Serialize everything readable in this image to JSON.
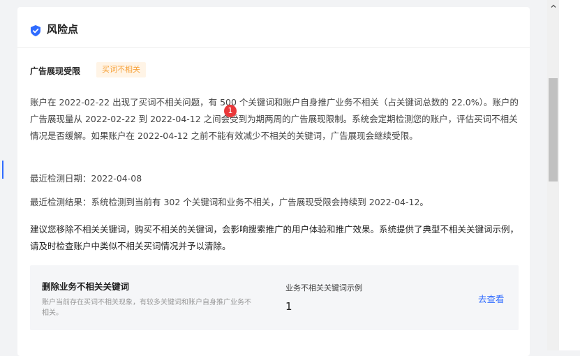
{
  "card": {
    "title": "风险点",
    "icon": "shield-check-icon",
    "accent_color": "#2f6bff"
  },
  "issue": {
    "title": "广告展现受限",
    "tag": "买词不相关",
    "tag_color": "#f7a23a"
  },
  "body": {
    "paragraph1": "账户在 2022-02-22 出现了买词不相关问题，有 500 个关键词和账户自身推广业务不相关（占关键词总数的 22.0%）。账户的广告展现量从 2022-02-22 到 2022-04-12 之间会受到为期两周的广告展现限制。系统会定期检测您的账户，评估买词不相关情况是否缓解。如果账户在 2022-04-12 之前不能有效减少不相关的关键词，广告展现会继续受限。",
    "latest_check_date": "最近检测日期：2022-04-08",
    "latest_check_result": "最近检测结果：系统检测到当前有 302 个关键词和业务不相关，广告展现受限会持续到 2022-04-12。",
    "suggestion": "建议您移除不相关关键词，购买不相关的关键词，会影响搜索推广的用户体验和推广效果。系统提供了典型不相关关键词示例，请及时检查账户中类似不相关买词情况并予以清除。"
  },
  "notification_badge": "1",
  "panel": {
    "title": "删除业务不相关关键词",
    "description": "账户当前存在买词不相关现象，有较多关键词和账户自身推广业务不相关。",
    "example_label": "业务不相关关键词示例",
    "example_count": "1",
    "link": "去查看",
    "link_color": "#2f6bff"
  },
  "scrollbar": {
    "up_arrow_icon": "chevron-up-icon"
  }
}
